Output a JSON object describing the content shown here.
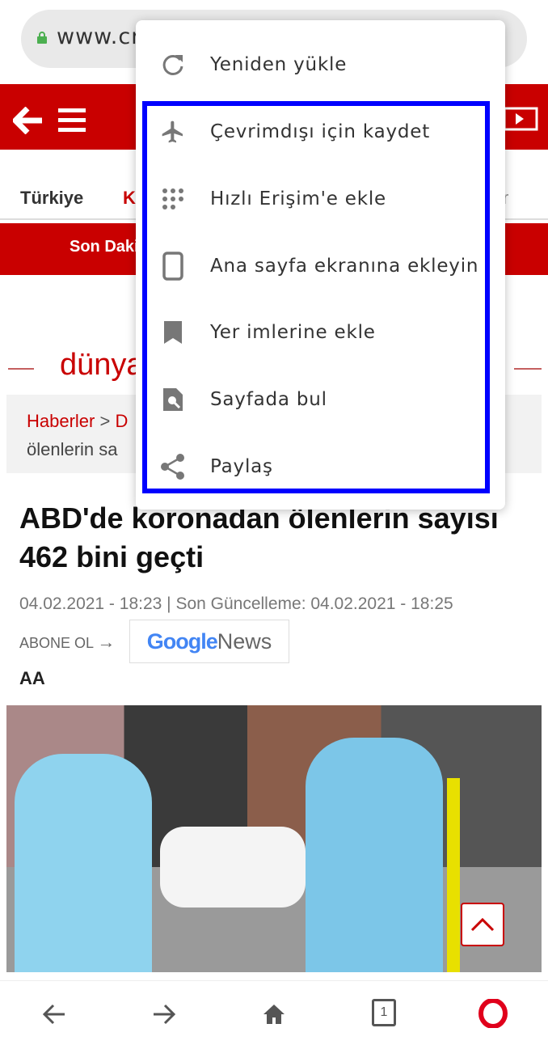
{
  "browser": {
    "url": "www.cr"
  },
  "site": {
    "nav": [
      "Türkiye",
      "K",
      "r"
    ],
    "breaking": "Son Daki",
    "section": "dünya",
    "breadcrumb": {
      "link": "Haberler",
      "sep": ">",
      "next": "D",
      "line2": "ölenlerin sa"
    }
  },
  "article": {
    "title": "ABD'de koronadan ölenlerin sayısı 462 bini geçti",
    "meta": "04.02.2021 - 18:23 | Son Güncelleme: 04.02.2021 - 18:25",
    "subscribe": "ABONE OL",
    "google_news": {
      "google": "Google",
      "news": "News"
    },
    "source": "AA"
  },
  "menu": {
    "items": [
      {
        "label": "Yeniden yükle",
        "icon": "reload-icon"
      },
      {
        "label": "Çevrimdışı için kaydet",
        "icon": "airplane-icon"
      },
      {
        "label": "Hızlı Erişim'e ekle",
        "icon": "grid-dots-icon"
      },
      {
        "label": "Ana sayfa ekranına ekleyin",
        "icon": "phone-icon"
      },
      {
        "label": "Yer imlerine ekle",
        "icon": "bookmark-icon"
      },
      {
        "label": "Sayfada bul",
        "icon": "find-in-page-icon"
      },
      {
        "label": "Paylaş",
        "icon": "share-icon"
      }
    ],
    "highlight_color": "#0000ff"
  },
  "bottom_nav": {
    "tabs_count": "1"
  },
  "colors": {
    "brand": "#c90000",
    "opera": "#e0001b"
  }
}
